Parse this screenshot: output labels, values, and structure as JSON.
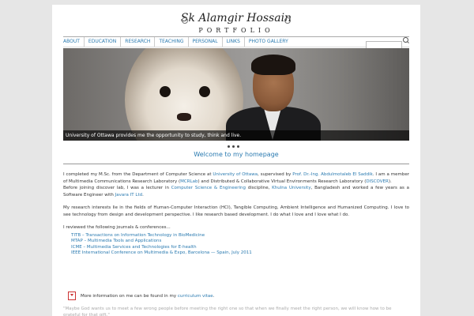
{
  "brand": {
    "name": "Sk Alamgir Hossain",
    "subtitle": "PORTFOLIO"
  },
  "nav": {
    "items": [
      "ABOUT",
      "EDUCATION",
      "RESEARCH",
      "TEACHING",
      "PERSONAL",
      "LINKS",
      "PHOTO GALLERY"
    ]
  },
  "search": {
    "placeholder": ""
  },
  "hero": {
    "caption": "University of Ottawa provides me the opportunity to study, think and live.",
    "slides": 3,
    "active_slide": 3
  },
  "welcome": "Welcome to my homepage",
  "content": {
    "p1_a": "I completed my M.Sc. from the Department of Computer Science at ",
    "p1_link1": "University of Ottawa",
    "p1_b": ", supervised by ",
    "p1_link2": "Prof. Dr.-Ing. Abdulmotaleb El Saddik",
    "p1_c": ". I am a member of Multimedia Communications Research Laboratory (",
    "p1_link3": "MCRLab",
    "p1_d": ") and Distributed & Collaborative Virtual Environments Research Laboratory (",
    "p1_link4": "DISCOVER",
    "p1_e": ").",
    "p2_a": "Before joining discover lab, I was a lecturer in ",
    "p2_link1": "Computer Science & Engineering",
    "p2_b": " discipline, ",
    "p2_link2": "Khulna University",
    "p2_c": ", Bangladesh and worked a few years as a Software Engineer with ",
    "p2_link3": "Javara IT Ltd",
    "p2_d": ".",
    "p3": "My research interests lie in the fields of Human-Computer Interaction (HCI), Tangible Computing, Ambient Intelligence and Humanized Computing. I love to see technology from design and development perspective. I like research based development. I do what I love and I love what I do.",
    "p4": "I reviewed the following journals & conferences...",
    "journals": [
      "TITB – Transactions on Information Technology in BioMedicine",
      "MTAP – Multimedia Tools and Applications",
      "ICME – Multimedia Services and Technologies for E-health",
      "IEEE International Conference on Multimedia & Expo, Barcelona — Spain, July 2011"
    ]
  },
  "cv": {
    "text": "More information on me can be found in my ",
    "link": "curriculum vitae",
    "end": "."
  },
  "quote": "\"Maybe God wants us to meet a few wrong people before meeting the right one so that when we finally meet the right person, we will know how to be grateful for that gift.\"",
  "colors": {
    "link": "#2a7ab0",
    "background": "#e6e6e6"
  }
}
